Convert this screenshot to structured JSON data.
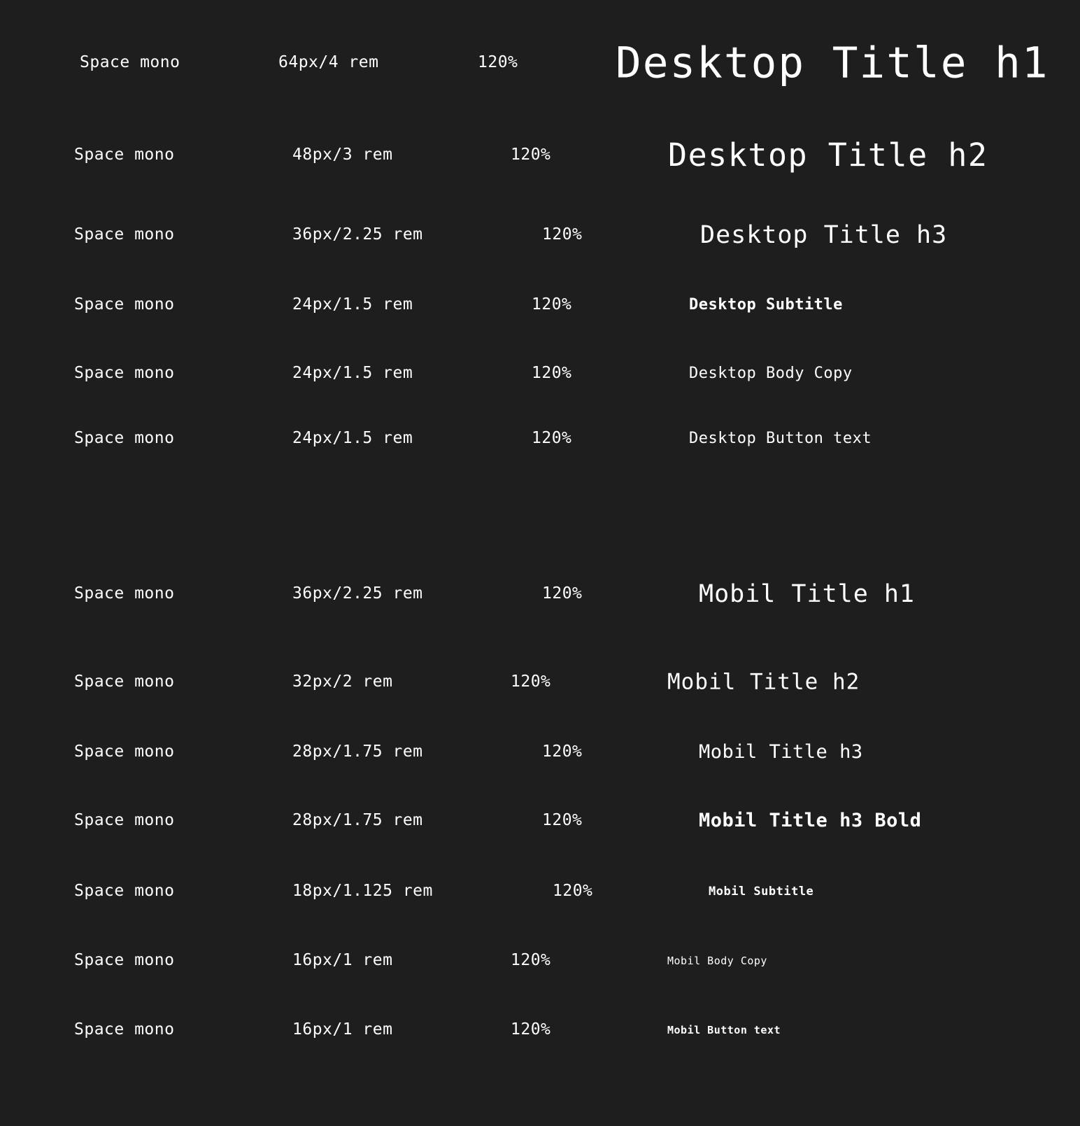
{
  "colors": {
    "background": "#1e1e1e",
    "text": "#ffffff"
  },
  "desktop_styles": [
    {
      "font": "Space mono",
      "size": "64px/4 rem",
      "line_height": "120%",
      "sample": "Desktop Title h1"
    },
    {
      "font": "Space mono",
      "size": "48px/3 rem",
      "line_height": "120%",
      "sample": "Desktop Title h2"
    },
    {
      "font": "Space mono",
      "size": "36px/2.25 rem",
      "line_height": "120%",
      "sample": "Desktop Title h3"
    },
    {
      "font": "Space mono",
      "size": "24px/1.5 rem",
      "line_height": "120%",
      "sample": "Desktop Subtitle"
    },
    {
      "font": "Space mono",
      "size": "24px/1.5 rem",
      "line_height": "120%",
      "sample": "Desktop Body Copy"
    },
    {
      "font": "Space mono",
      "size": "24px/1.5 rem",
      "line_height": "120%",
      "sample": "Desktop Button text"
    }
  ],
  "mobile_styles": [
    {
      "font": "Space mono",
      "size": "36px/2.25 rem",
      "line_height": "120%",
      "sample": "Mobil Title h1"
    },
    {
      "font": "Space mono",
      "size": "32px/2 rem",
      "line_height": "120%",
      "sample": "Mobil Title h2"
    },
    {
      "font": "Space mono",
      "size": "28px/1.75 rem",
      "line_height": "120%",
      "sample": "Mobil Title h3"
    },
    {
      "font": "Space mono",
      "size": "28px/1.75 rem",
      "line_height": "120%",
      "sample": "Mobil Title h3 Bold"
    },
    {
      "font": "Space mono",
      "size": "18px/1.125 rem",
      "line_height": "120%",
      "sample": "Mobil Subtitle"
    },
    {
      "font": "Space mono",
      "size": "16px/1 rem",
      "line_height": "120%",
      "sample": "Mobil Body Copy"
    },
    {
      "font": "Space mono",
      "size": "16px/1 rem",
      "line_height": "120%",
      "sample": "Mobil Button text"
    }
  ]
}
